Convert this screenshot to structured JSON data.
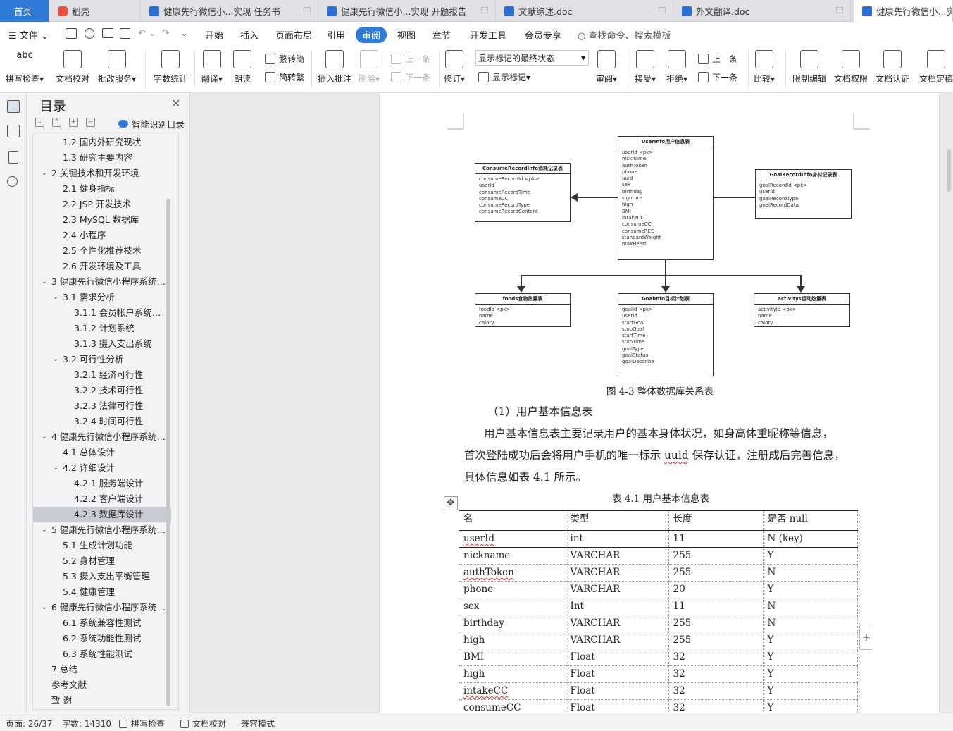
{
  "tabs": [
    {
      "label": "首页",
      "kind": "home"
    },
    {
      "label": "稻壳",
      "kind": "daoke"
    },
    {
      "label": "健康先行微信小...实现 任务书",
      "kind": "doc"
    },
    {
      "label": "健康先行微信小...实现 开题报告",
      "kind": "doc"
    },
    {
      "label": "文献综述.doc",
      "kind": "doc"
    },
    {
      "label": "外文翻译.doc",
      "kind": "doc"
    },
    {
      "label": "健康先行微信小...实现",
      "kind": "doc",
      "active": true
    }
  ],
  "menu": {
    "file": "文件",
    "items": [
      "开始",
      "插入",
      "页面布局",
      "引用",
      "审阅",
      "视图",
      "章节",
      "开发工具",
      "会员专享"
    ],
    "active": "审阅",
    "search": "查找命令、搜索模板"
  },
  "ribbon": {
    "spell": "拼写检查",
    "proof": "文档校对",
    "batch": "批改服务",
    "wordcount": "字数统计",
    "translate": "翻译",
    "read": "朗读",
    "trad": "繁转简",
    "simp": "简转繁",
    "insert_comment": "插入批注",
    "delete": "删除",
    "prev_comment": "上一条",
    "next_comment": "下一条",
    "track": "修订",
    "markup_state": "显示标记的最终状态",
    "show_markup": "显示标记",
    "review": "审阅",
    "accept": "接受",
    "reject": "拒绝",
    "prev": "上一条",
    "next": "下一条",
    "compare": "比较",
    "restrict": "限制编辑",
    "permission": "文档权限",
    "cert": "文档认证",
    "final": "文档定稿"
  },
  "toc": {
    "title": "目录",
    "smart": "智能识别目录",
    "items": [
      {
        "level": 2,
        "text": "1.2 国内外研究现状"
      },
      {
        "level": 2,
        "text": "1.3 研究主要内容"
      },
      {
        "level": 1,
        "text": "2 关键技术和开发环境",
        "expand": "open"
      },
      {
        "level": 2,
        "text": "2.1 健身指标"
      },
      {
        "level": 2,
        "text": "2.2 JSP 开发技术"
      },
      {
        "level": 2,
        "text": "2.3 MySQL 数据库"
      },
      {
        "level": 2,
        "text": "2.4 小程序"
      },
      {
        "level": 2,
        "text": "2.5 个性化推荐技术"
      },
      {
        "level": 2,
        "text": "2.6 开发环境及工具"
      },
      {
        "level": 1,
        "text": "3 健康先行微信小程序系统 ...",
        "expand": "open"
      },
      {
        "level": 2,
        "text": "3.1 需求分析",
        "expand": "open"
      },
      {
        "level": 3,
        "text": "3.1.1 会员帐户系统需 ..."
      },
      {
        "level": 3,
        "text": "3.1.2 计划系统"
      },
      {
        "level": 3,
        "text": "3.1.3 摄入支出系统"
      },
      {
        "level": 2,
        "text": "3.2 可行性分析",
        "expand": "open"
      },
      {
        "level": 3,
        "text": "3.2.1 经济可行性"
      },
      {
        "level": 3,
        "text": "3.2.2 技术可行性"
      },
      {
        "level": 3,
        "text": "3.2.3 法律可行性"
      },
      {
        "level": 3,
        "text": "3.2.4 时间可行性"
      },
      {
        "level": 1,
        "text": "4 健康先行微信小程序系统 ...",
        "expand": "open"
      },
      {
        "level": 2,
        "text": "4.1 总体设计"
      },
      {
        "level": 2,
        "text": "4.2 详细设计",
        "expand": "open"
      },
      {
        "level": 3,
        "text": "4.2.1 服务端设计"
      },
      {
        "level": 3,
        "text": "4.2.2 客户端设计"
      },
      {
        "level": 3,
        "text": "4.2.3 数据库设计",
        "selected": true
      },
      {
        "level": 1,
        "text": "5 健康先行微信小程序系统 ...",
        "expand": "open"
      },
      {
        "level": 2,
        "text": "5.1 生成计划功能"
      },
      {
        "level": 2,
        "text": "5.2 身材管理"
      },
      {
        "level": 2,
        "text": "5.3 摄入支出平衡管理"
      },
      {
        "level": 2,
        "text": "5.4 健康管理"
      },
      {
        "level": 1,
        "text": "6 健康先行微信小程序系统 ...",
        "expand": "open"
      },
      {
        "level": 2,
        "text": "6.1 系统兼容性测试"
      },
      {
        "level": 2,
        "text": "6.2 系统功能性测试"
      },
      {
        "level": 2,
        "text": "6.3 系统性能测试"
      },
      {
        "level": 1,
        "text": "7 总结"
      },
      {
        "level": 1,
        "text": "参考文献"
      },
      {
        "level": 1,
        "text": "致  谢"
      }
    ]
  },
  "diagram": {
    "userinfo": {
      "title": "UserInfo用户信息表",
      "fields": [
        "userId      <pk>",
        "nickname",
        "authToken",
        "phone",
        "uuid",
        "sex",
        "birthday",
        "signture",
        "high",
        "BMI",
        "intakeCC",
        "consumeCC",
        "consumeREE",
        "standardWeight",
        "maxHeart"
      ]
    },
    "consume": {
      "title": "ConsumeRecordInfo消耗记录表",
      "fields": [
        "consumeRecordId    <pk>",
        "userId",
        "consumeRecordTime",
        "consumeCC",
        "consumeRecordType",
        "consumeRecordContent"
      ]
    },
    "goalrecord": {
      "title": "GoalRecordInfo身材记录表",
      "fields": [
        "goalRecordId     <pk>",
        "userId",
        "goalRecordType",
        "goalRecordData"
      ]
    },
    "foods": {
      "title": "foods食物热量表",
      "fields": [
        "foodId     <pk>",
        "name",
        "calory"
      ]
    },
    "goalinfo": {
      "title": "GoalInfo目标计划表",
      "fields": [
        "goalId      <pk>",
        "userId",
        "startGoal",
        "stopGoal",
        "startTime",
        "stopTime",
        "goalType",
        "goalStatus",
        "goalDescribe"
      ]
    },
    "activitys": {
      "title": "activitys运动热量表",
      "fields": [
        "activityId     <pk>",
        "name",
        "calory"
      ]
    },
    "caption": "图 4-3 整体数据库关系表"
  },
  "body": {
    "heading": "（1）用户基本信息表",
    "p1": "用户基本信息表主要记录用户的基本身体状况，如身高体重昵称等信息，",
    "p2a": "首次登陆成功后会将用户手机的唯一标示 ",
    "p2b": "uuid",
    "p2c": " 保存认证，注册成后完善信息，",
    "p3": "具体信息如表 4.1 所示。",
    "table_caption": "表 4.1 用户基本信息表"
  },
  "table": {
    "headers": [
      "名",
      "类型",
      "长度",
      "是否 null"
    ],
    "rows": [
      [
        "userId",
        "int",
        "11",
        "N (key)"
      ],
      [
        "nickname",
        "VARCHAR",
        "255",
        "Y"
      ],
      [
        "authToken",
        "VARCHAR",
        "255",
        "N"
      ],
      [
        "phone",
        "VARCHAR",
        "20",
        "Y"
      ],
      [
        "sex",
        "Int",
        "11",
        "N"
      ],
      [
        "birthday",
        "VARCHAR",
        "255",
        "N"
      ],
      [
        "high",
        "VARCHAR",
        "255",
        "Y"
      ],
      [
        "BMI",
        "Float",
        "32",
        "Y"
      ],
      [
        "high",
        "Float",
        "32",
        "Y"
      ],
      [
        "intakeCC",
        "Float",
        "32",
        "Y"
      ],
      [
        "consumeCC",
        "Float",
        "32",
        "Y"
      ]
    ]
  },
  "status": {
    "page": "页面: 26/37",
    "words": "字数: 14310",
    "spell": "拼写检查",
    "proof": "文档校对",
    "mode": "兼容模式"
  }
}
